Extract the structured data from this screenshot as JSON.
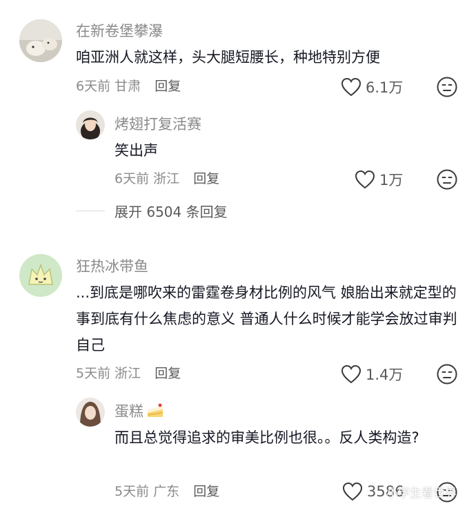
{
  "comments": [
    {
      "username": "在新卷堡攀瀑",
      "text": "咱亚洲人就这样，头大腿短腰长，种地特别方便",
      "time": "6天前",
      "location": "甘肃",
      "reply_label": "回复",
      "likes": "6.1万"
    },
    {
      "username": "狂热冰带鱼",
      "text": "...到底是哪吹来的雷霆卷身材比例的风气 娘胎出来就定型的事到底有什么焦虑的意义 普通人什么时候才能学会放过审判自己",
      "time": "5天前",
      "location": "浙江",
      "reply_label": "回复",
      "likes": "1.4万"
    }
  ],
  "replies": [
    {
      "username": "烤翅打复活赛",
      "text": "笑出声",
      "time": "6天前",
      "location": "浙江",
      "reply_label": "回复",
      "likes": "1万"
    },
    {
      "username": "蛋糕",
      "text": "而且总觉得追求的审美比例也很。。反人类构造?",
      "time": "5天前",
      "location": "广东",
      "reply_label": "回复",
      "likes": "3586"
    }
  ],
  "expand_replies": "展开 6504 条回复",
  "watermark": "小学生看世界",
  "icons": {
    "like": "heart-outline-icon",
    "dislike": "meh-face-icon",
    "cake": "cake-emoji-icon"
  }
}
